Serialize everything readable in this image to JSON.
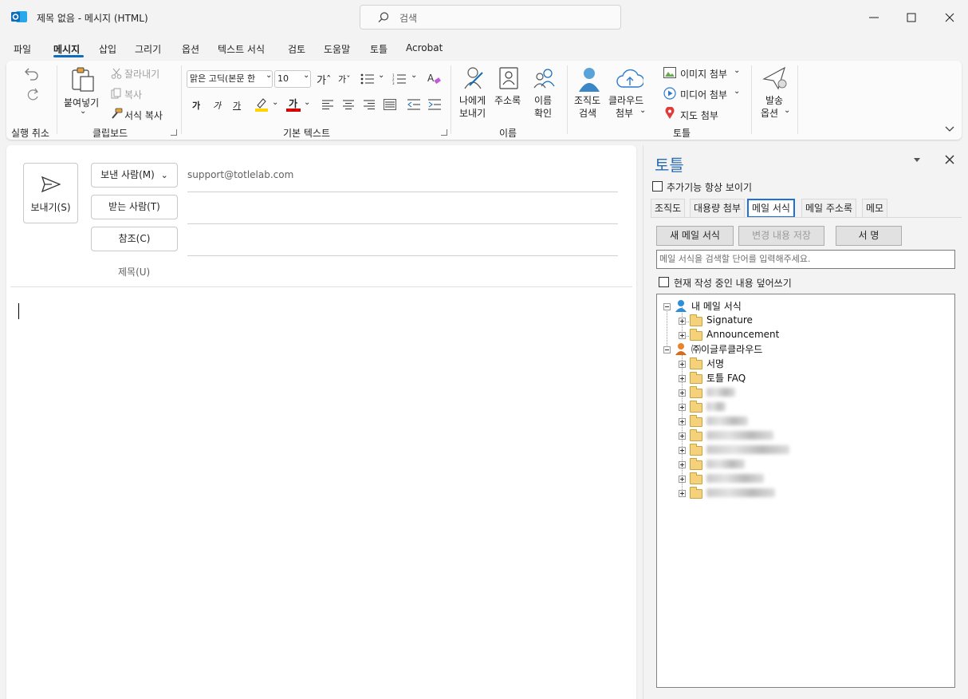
{
  "window": {
    "title": "제목 없음  -  메시지 (HTML)",
    "search_label": "검색"
  },
  "menu": {
    "tabs": [
      {
        "label": "파일"
      },
      {
        "label": "메시지"
      },
      {
        "label": "삽입"
      },
      {
        "label": "그리기"
      },
      {
        "label": "옵션"
      },
      {
        "label": "텍스트 서식"
      },
      {
        "label": "검토"
      },
      {
        "label": "도움말"
      },
      {
        "label": "토틀"
      },
      {
        "label": "Acrobat"
      }
    ]
  },
  "ribbon": {
    "undo_group": "실행 취소",
    "clipboard": {
      "group": "클립보드",
      "paste": "붙여넣기",
      "cut": "잘라내기",
      "copy": "복사",
      "format_painter": "서식 복사"
    },
    "basic_text": {
      "group": "기본 텍스트",
      "font": "맑은 고딕(본문 한",
      "size": "10",
      "bold": "가",
      "italic": "가",
      "underline": "가",
      "font_color": "가"
    },
    "names": {
      "group": "이름",
      "send_to_me_line1": "나에게",
      "send_to_me_line2": "보내기",
      "address_book": "주소록",
      "check_names_line1": "이름",
      "check_names_line2": "확인"
    },
    "totle": {
      "group": "토틀",
      "org_line1": "조직도",
      "org_line2": "검색",
      "cloud_line1": "클라우드",
      "cloud_line2": "첨부",
      "image_attach": "이미지 첨부",
      "media_attach": "미디어 첨부",
      "map_attach": "지도 첨부"
    },
    "send_options_line1": "발송",
    "send_options_line2": "옵션"
  },
  "compose": {
    "send": "보내기(S)",
    "from": "보낸 사람(M)",
    "from_address": "support@totlelab.com",
    "to": "받는 사람(T)",
    "cc": "참조(C)",
    "subject": "제목(U)"
  },
  "pane": {
    "title": "토틀",
    "always_show": "추가기능 항상 보이기",
    "tabs": [
      {
        "label": "조직도"
      },
      {
        "label": "대용량 첨부"
      },
      {
        "label": "메일 서식"
      },
      {
        "label": "메일 주소록"
      },
      {
        "label": "메모"
      }
    ],
    "new_template": "새 메일 서식",
    "save_changes": "변경 내용 저장",
    "signature": "서 명",
    "search_placeholder": "메일 서식을 검색할 단어를 입력해주세요.",
    "overwrite": "현재 작성 중인 내용 덮어쓰기",
    "tree": {
      "my_templates": "내 메일 서식",
      "signature_folder": "Signature",
      "announcement_folder": "Announcement",
      "company": "㈜이글루클라우드",
      "sign_folder": "서명",
      "faq_folder": "토틀 FAQ"
    }
  },
  "colors": {
    "accent": "#0f6cbd",
    "highlight_yellow": "#ffd400",
    "font_red": "#d40000"
  }
}
